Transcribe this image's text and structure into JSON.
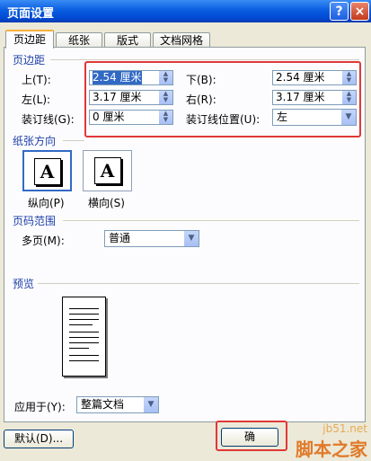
{
  "window": {
    "title": "页面设置",
    "help_label": "?",
    "close_label": "×"
  },
  "tabs": [
    {
      "label": "页边距",
      "active": true
    },
    {
      "label": "纸张",
      "active": false
    },
    {
      "label": "版式",
      "active": false
    },
    {
      "label": "文档网格",
      "active": false
    }
  ],
  "margins": {
    "group_title": "页边距",
    "top_label": "上(T):",
    "top_value": "2.54 厘米",
    "bottom_label": "下(B):",
    "bottom_value": "2.54 厘米",
    "left_label": "左(L):",
    "left_value": "3.17 厘米",
    "right_label": "右(R):",
    "right_value": "3.17 厘米",
    "gutter_label": "装订线(G):",
    "gutter_value": "0 厘米",
    "gutter_pos_label": "装订线位置(U):",
    "gutter_pos_value": "左"
  },
  "orientation": {
    "group_title": "纸张方向",
    "portrait_label": "纵向(P)",
    "landscape_label": "横向(S)",
    "icon_letter": "A",
    "selected": "portrait"
  },
  "pages": {
    "group_title": "页码范围",
    "multi_label": "多页(M):",
    "multi_value": "普通"
  },
  "preview": {
    "group_title": "预览",
    "apply_label": "应用于(Y):",
    "apply_value": "整篇文档"
  },
  "footer": {
    "default_button": "默认(D)...",
    "ok_button": "确"
  },
  "watermark": {
    "site": "jb51.net",
    "name": "脚本之家"
  },
  "colors": {
    "group_title": "#1d3fa8",
    "highlight_box": "#e03838",
    "titlebar": "#0a5ee0"
  }
}
